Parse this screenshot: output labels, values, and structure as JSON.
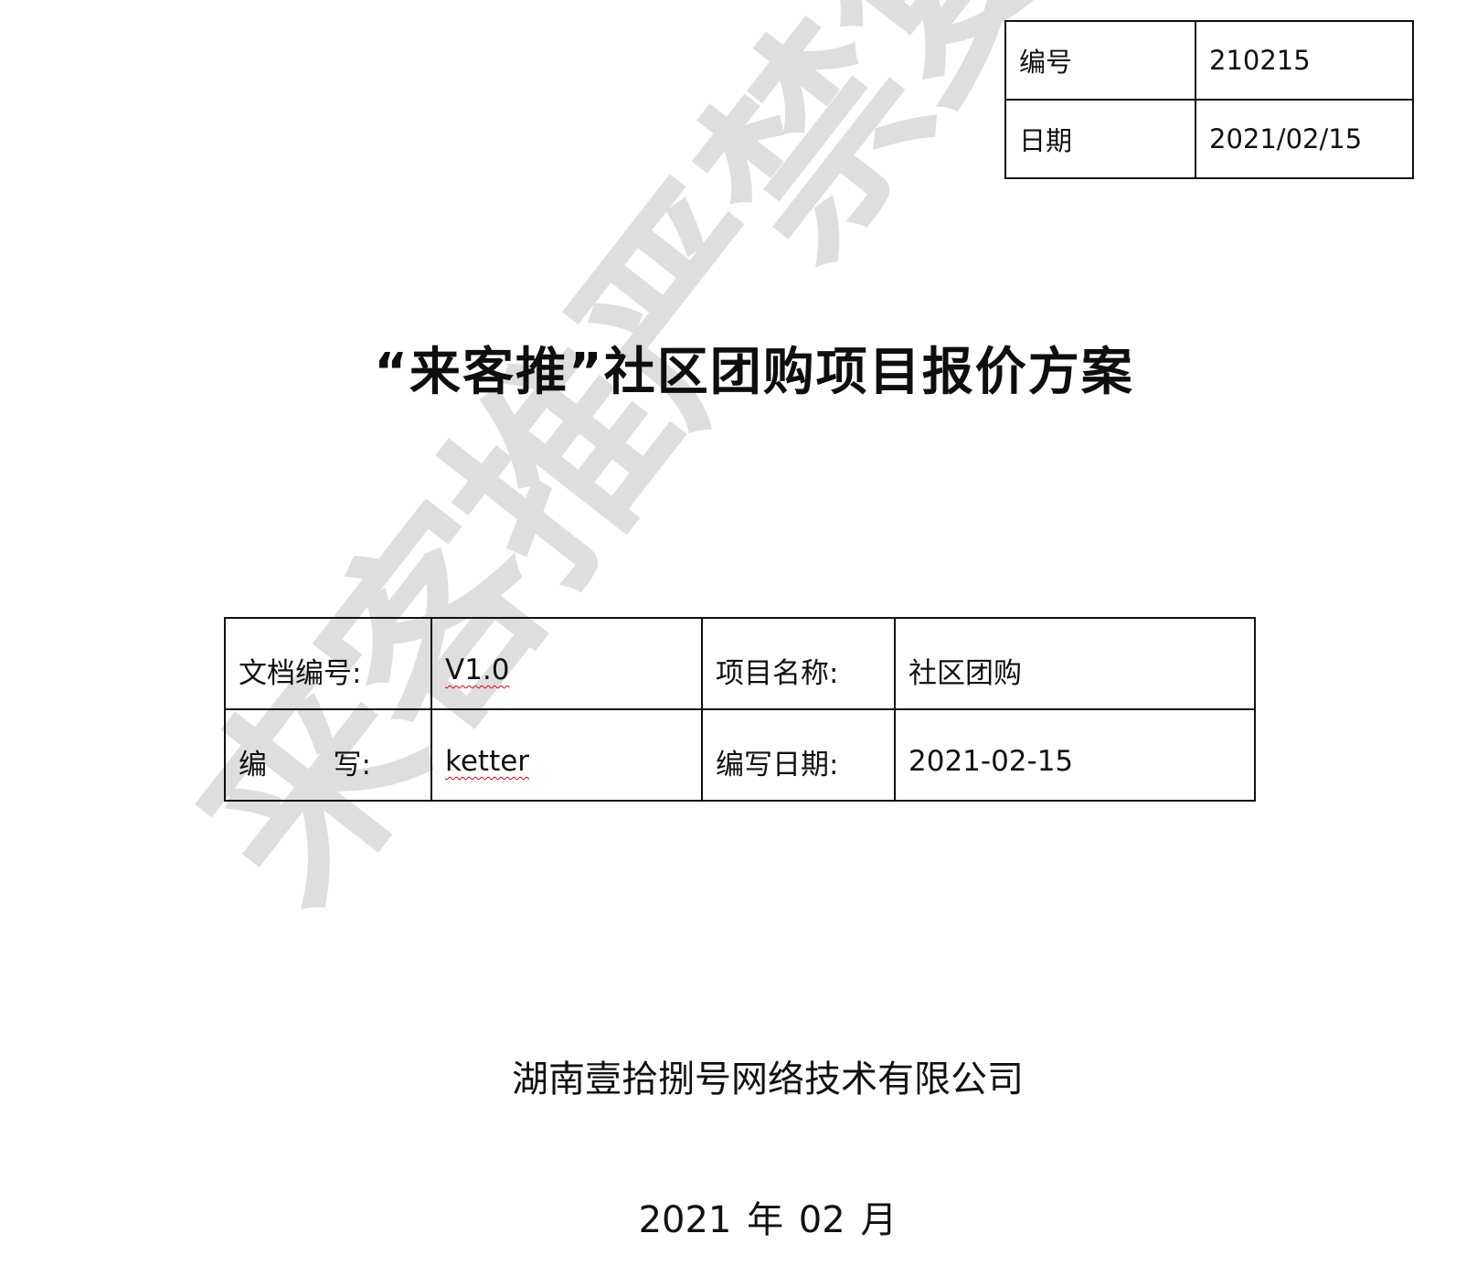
{
  "meta": {
    "rows": [
      {
        "label": "编号",
        "value": "210215"
      },
      {
        "label": "日期",
        "value": "2021/02/15"
      }
    ]
  },
  "title": "“来客推”社区团购项目报价方案",
  "info": {
    "doc_number_label": "文档编号:",
    "doc_number_value": "V1.0",
    "project_name_label": "项目名称:",
    "project_name_value": "社区团购",
    "author_label_first": "编",
    "author_label_second": "写:",
    "author_value": "ketter",
    "write_date_label": "编写日期:",
    "write_date_value": "2021-02-15"
  },
  "company": "湖南壹拾捌号网络技术有限公司",
  "date_line": "2021 年 02 月",
  "watermark": {
    "text": "来客推严禁复制",
    "color": "#dedede"
  },
  "colors": {
    "text": "#111111",
    "border": "#111111",
    "spellcheck_underline": "#e00000",
    "background": "#ffffff"
  }
}
